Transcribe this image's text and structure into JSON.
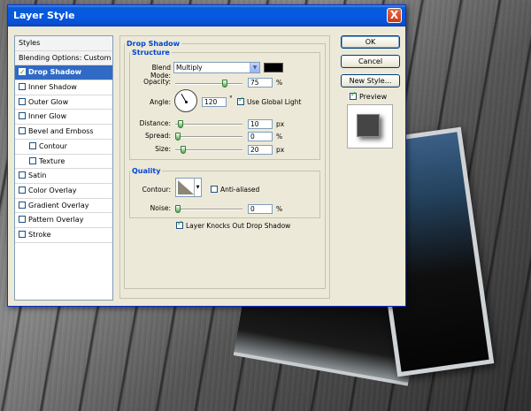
{
  "window": {
    "title": "Layer Style",
    "close_label": "X"
  },
  "styles_panel": {
    "items": [
      {
        "label": "Styles",
        "type": "header",
        "checkbox": false
      },
      {
        "label": "Blending Options: Custom",
        "type": "header",
        "checkbox": false
      },
      {
        "label": "Drop Shadow",
        "type": "item",
        "checkbox": true,
        "checked": true,
        "selected": true
      },
      {
        "label": "Inner Shadow",
        "type": "item",
        "checkbox": true,
        "checked": false
      },
      {
        "label": "Outer Glow",
        "type": "item",
        "checkbox": true,
        "checked": false
      },
      {
        "label": "Inner Glow",
        "type": "item",
        "checkbox": true,
        "checked": false
      },
      {
        "label": "Bevel and Emboss",
        "type": "item",
        "checkbox": true,
        "checked": false
      },
      {
        "label": "Contour",
        "type": "subitem",
        "checkbox": true,
        "checked": false
      },
      {
        "label": "Texture",
        "type": "subitem",
        "checkbox": true,
        "checked": false
      },
      {
        "label": "Satin",
        "type": "item",
        "checkbox": true,
        "checked": false
      },
      {
        "label": "Color Overlay",
        "type": "item",
        "checkbox": true,
        "checked": false
      },
      {
        "label": "Gradient Overlay",
        "type": "item",
        "checkbox": true,
        "checked": false
      },
      {
        "label": "Pattern Overlay",
        "type": "item",
        "checkbox": true,
        "checked": false
      },
      {
        "label": "Stroke",
        "type": "item",
        "checkbox": true,
        "checked": false
      }
    ]
  },
  "drop_shadow": {
    "section_title": "Drop Shadow",
    "structure": {
      "title": "Structure",
      "blend_mode_label": "Blend Mode:",
      "blend_mode_value": "Multiply",
      "shadow_color": "#000000",
      "opacity_label": "Opacity:",
      "opacity_value": "75",
      "opacity_unit": "%",
      "opacity_fraction": 0.75,
      "angle_label": "Angle:",
      "angle_value": "120",
      "angle_unit": "°",
      "use_global_light_label": "Use Global Light",
      "use_global_light_checked": true,
      "distance_label": "Distance:",
      "distance_value": "10",
      "distance_unit": "px",
      "distance_fraction": 0.04,
      "spread_label": "Spread:",
      "spread_value": "0",
      "spread_unit": "%",
      "spread_fraction": 0.0,
      "size_label": "Size:",
      "size_value": "20",
      "size_unit": "px",
      "size_fraction": 0.08
    },
    "quality": {
      "title": "Quality",
      "contour_label": "Contour:",
      "anti_aliased_label": "Anti-aliased",
      "anti_aliased_checked": false,
      "noise_label": "Noise:",
      "noise_value": "0",
      "noise_unit": "%",
      "noise_fraction": 0.0
    },
    "knockout_label": "Layer Knocks Out Drop Shadow",
    "knockout_checked": true
  },
  "buttons": {
    "ok": "OK",
    "cancel": "Cancel",
    "new_style": "New Style...",
    "preview_label": "Preview",
    "preview_checked": true
  }
}
